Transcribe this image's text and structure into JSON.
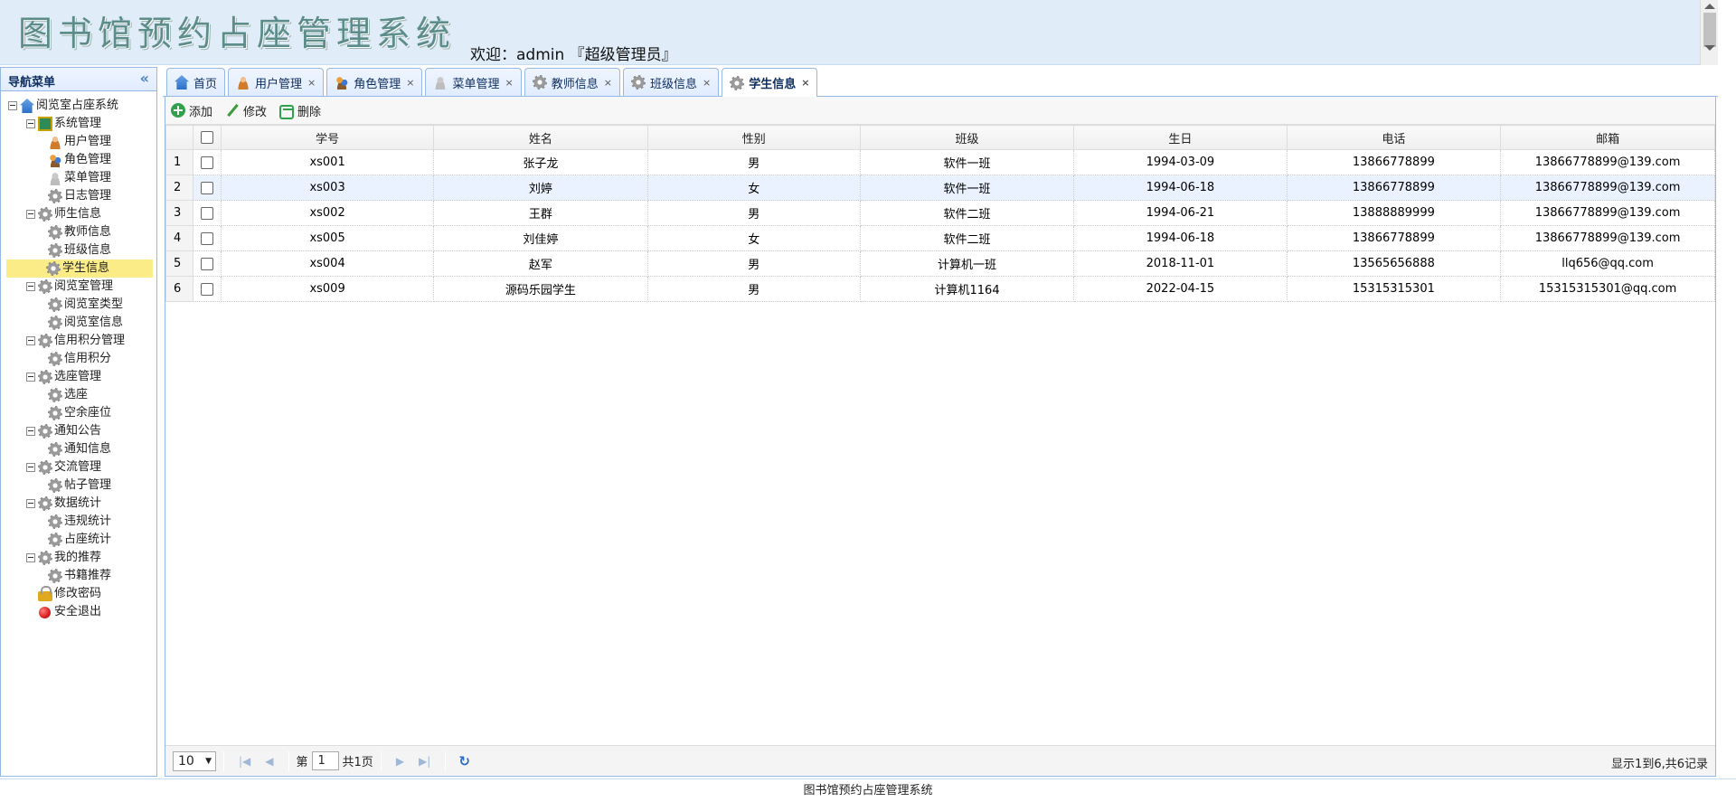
{
  "header": {
    "title": "图书馆预约占座管理系统",
    "welcome": "欢迎：admin 『超级管理员』"
  },
  "sidebar": {
    "title": "导航菜单",
    "tree": [
      {
        "label": "阅览室占座系统",
        "level": 0,
        "icon": "home-icon"
      },
      {
        "label": "系统管理",
        "level": 1,
        "icon": "system-icon"
      },
      {
        "label": "用户管理",
        "level": 2,
        "icon": "user-icon"
      },
      {
        "label": "角色管理",
        "level": 2,
        "icon": "role-icon"
      },
      {
        "label": "菜单管理",
        "level": 2,
        "icon": "menu-icon"
      },
      {
        "label": "日志管理",
        "level": 2,
        "icon": "gear-icon"
      },
      {
        "label": "师生信息",
        "level": 1,
        "icon": "gear-icon"
      },
      {
        "label": "教师信息",
        "level": 2,
        "icon": "gear-icon"
      },
      {
        "label": "班级信息",
        "level": 2,
        "icon": "gear-icon"
      },
      {
        "label": "学生信息",
        "level": 2,
        "icon": "gear-icon",
        "selected": true
      },
      {
        "label": "阅览室管理",
        "level": 1,
        "icon": "gear-icon"
      },
      {
        "label": "阅览室类型",
        "level": 2,
        "icon": "gear-icon"
      },
      {
        "label": "阅览室信息",
        "level": 2,
        "icon": "gear-icon"
      },
      {
        "label": "信用积分管理",
        "level": 1,
        "icon": "gear-icon"
      },
      {
        "label": "信用积分",
        "level": 2,
        "icon": "gear-icon"
      },
      {
        "label": "选座管理",
        "level": 1,
        "icon": "gear-icon"
      },
      {
        "label": "选座",
        "level": 2,
        "icon": "gear-icon"
      },
      {
        "label": "空余座位",
        "level": 2,
        "icon": "gear-icon"
      },
      {
        "label": "通知公告",
        "level": 1,
        "icon": "gear-icon"
      },
      {
        "label": "通知信息",
        "level": 2,
        "icon": "gear-icon"
      },
      {
        "label": "交流管理",
        "level": 1,
        "icon": "gear-icon"
      },
      {
        "label": "帖子管理",
        "level": 2,
        "icon": "gear-icon"
      },
      {
        "label": "数据统计",
        "level": 1,
        "icon": "gear-icon"
      },
      {
        "label": "违规统计",
        "level": 2,
        "icon": "gear-icon"
      },
      {
        "label": "占座统计",
        "level": 2,
        "icon": "gear-icon"
      },
      {
        "label": "我的推荐",
        "level": 1,
        "icon": "gear-icon"
      },
      {
        "label": "书籍推荐",
        "level": 2,
        "icon": "gear-icon"
      },
      {
        "label": "修改密码",
        "level": 1,
        "icon": "lock-icon"
      },
      {
        "label": "安全退出",
        "level": 1,
        "icon": "exit-icon"
      }
    ]
  },
  "tabs": [
    {
      "label": "首页",
      "icon": "home-icon",
      "closable": false
    },
    {
      "label": "用户管理",
      "icon": "user-icon",
      "closable": true
    },
    {
      "label": "角色管理",
      "icon": "role-icon",
      "closable": true
    },
    {
      "label": "菜单管理",
      "icon": "menu-icon",
      "closable": true
    },
    {
      "label": "教师信息",
      "icon": "gear-icon",
      "closable": true
    },
    {
      "label": "班级信息",
      "icon": "gear-icon",
      "closable": true
    },
    {
      "label": "学生信息",
      "icon": "gear-icon",
      "closable": true,
      "active": true
    }
  ],
  "tab_close_glyph": "×",
  "toolbar": {
    "add_label": "添加",
    "edit_label": "修改",
    "delete_label": "删除"
  },
  "table": {
    "columns": [
      "学号",
      "姓名",
      "性别",
      "班级",
      "生日",
      "电话",
      "邮箱"
    ],
    "rows": [
      {
        "n": "1",
        "cells": [
          "xs001",
          "张子龙",
          "男",
          "软件一班",
          "1994-03-09",
          "13866778899",
          "13866778899@139.com"
        ]
      },
      {
        "n": "2",
        "cells": [
          "xs003",
          "刘婷",
          "女",
          "软件一班",
          "1994-06-18",
          "13866778899",
          "13866778899@139.com"
        ]
      },
      {
        "n": "3",
        "cells": [
          "xs002",
          "王群",
          "男",
          "软件二班",
          "1994-06-21",
          "13888889999",
          "13866778899@139.com"
        ]
      },
      {
        "n": "4",
        "cells": [
          "xs005",
          "刘佳婷",
          "女",
          "软件二班",
          "1994-06-18",
          "13866778899",
          "13866778899@139.com"
        ]
      },
      {
        "n": "5",
        "cells": [
          "xs004",
          "赵军",
          "男",
          "计算机一班",
          "2018-11-01",
          "13565656888",
          "llq656@qq.com"
        ]
      },
      {
        "n": "6",
        "cells": [
          "xs009",
          "源码乐园学生",
          "男",
          "计算机1164",
          "2022-04-15",
          "15315315301",
          "15315315301@qq.com"
        ]
      }
    ]
  },
  "pager": {
    "page_size": "10",
    "page_prefix": "第",
    "page_value": "1",
    "page_total": "共1页",
    "info": "显示1到6,共6记录"
  },
  "footer": {
    "text": "图书馆预约占座管理系统"
  },
  "colors": {
    "header_bg": "#e0ecf8",
    "panel_border": "#95b8e7",
    "selected_node": "#fbec88",
    "alt_row": "#eaf2ff"
  }
}
